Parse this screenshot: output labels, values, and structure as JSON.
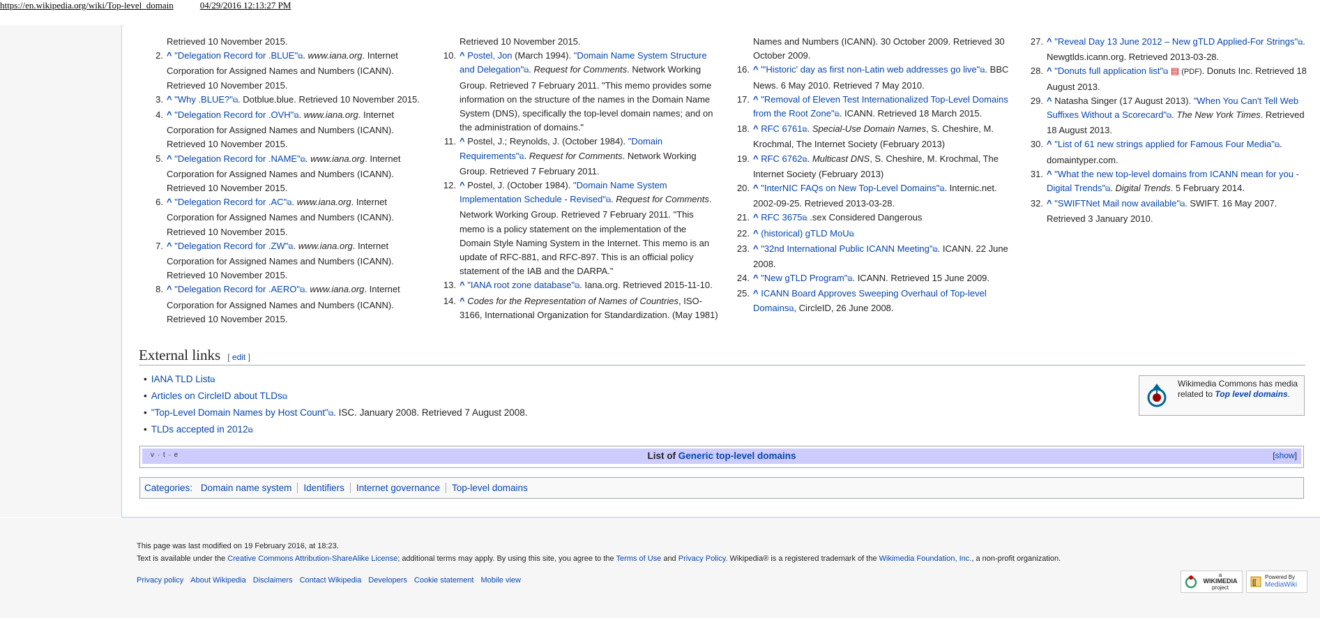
{
  "browser": {
    "url": "https://en.wikipedia.org/wiki/Top-level_domain",
    "timestamp": "04/29/2016 12:13:27 PM"
  },
  "references": {
    "col1_top": "Retrieved 10 November 2015.",
    "col1": [
      {
        "num": "2.",
        "title": "\"Delegation Record for .BLUE\"",
        "site": "www.iana.org",
        "rest": ". Internet Corporation for Assigned Names and Numbers (ICANN). Retrieved 10 November 2015."
      },
      {
        "num": "3.",
        "title": "\"Why .BLUE?\"",
        "site": "",
        "rest": ". Dotblue.blue. Retrieved 10 November 2015."
      },
      {
        "num": "4.",
        "title": "\"Delegation Record for .OVH\"",
        "site": "www.iana.org",
        "rest": ". Internet Corporation for Assigned Names and Numbers (ICANN). Retrieved 10 November 2015."
      },
      {
        "num": "5.",
        "title": "\"Delegation Record for .NAME\"",
        "site": "www.iana.org",
        "rest": ". Internet Corporation for Assigned Names and Numbers (ICANN). Retrieved 10 November 2015."
      },
      {
        "num": "6.",
        "title": "\"Delegation Record for .AC\"",
        "site": "www.iana.org",
        "rest": ". Internet Corporation for Assigned Names and Numbers (ICANN). Retrieved 10 November 2015."
      },
      {
        "num": "7.",
        "title": "\"Delegation Record for .ZW\"",
        "site": "www.iana.org",
        "rest": ". Internet Corporation for Assigned Names and Numbers (ICANN). Retrieved 10 November 2015."
      },
      {
        "num": "8.",
        "title": "\"Delegation Record for .AERO\"",
        "site": "www.iana.org",
        "rest": ". Internet Corporation for Assigned Names and Numbers (ICANN). Retrieved 10 November 2015."
      }
    ],
    "col2_top": "Retrieved 10 November 2015.",
    "col2": [
      {
        "num": "10.",
        "pre": "Postel, Jon",
        "pre_link": true,
        "mid": " (March 1994). ",
        "title": "\"Domain Name System Structure and Delegation\"",
        "italic": "Request for Comments",
        "rest": ". Network Working Group. Retrieved 7 February 2011. \"This memo provides some information on the structure of the names in the Domain Name System (DNS), specifically the top-level domain names; and on the administration of domains.\""
      },
      {
        "num": "11.",
        "pre": "Postel, J.; Reynolds, J.",
        "pre_link": false,
        "mid": " (October 1984). ",
        "title": "\"Domain Requirements\"",
        "italic": "Request for Comments",
        "rest": ". Network Working Group. Retrieved 7 February 2011."
      },
      {
        "num": "12.",
        "pre": "Postel, J.",
        "pre_link": false,
        "mid": " (October 1984). ",
        "title": "\"Domain Name System Implementation Schedule - Revised\"",
        "italic": "Request for Comments",
        "rest": ". Network Working Group. Retrieved 7 February 2011. \"This memo is a policy statement on the implementation of the Domain Style Naming System in the Internet. This memo is an update of RFC-881, and RFC-897. This is an official policy statement of the IAB and the DARPA.\""
      },
      {
        "num": "13.",
        "pre": "",
        "pre_link": false,
        "mid": "",
        "title": "\"IANA root zone database\"",
        "italic": "",
        "rest": ". Iana.org. Retrieved 2015-11-10."
      },
      {
        "num": "14.",
        "pre": "",
        "pre_link": false,
        "mid": "",
        "title": "",
        "italic": "Codes for the Representation of Names of Countries",
        "rest": ", ISO-3166, International Organization for Standardization. (May 1981)"
      }
    ],
    "col3_top": "Names and Numbers (ICANN). 30 October 2009. Retrieved 30 October 2009.",
    "col3": [
      {
        "num": "16.",
        "title": "\"'Historic' day as first non-Latin web addresses go live\"",
        "rest": ". BBC News. 6 May 2010. Retrieved 7 May 2010."
      },
      {
        "num": "17.",
        "title": "\"Removal of Eleven Test Internationalized Top-Level Domains from the Root Zone\"",
        "rest": ". ICANN. Retrieved 18 March 2015."
      },
      {
        "num": "18.",
        "title": "RFC 6761",
        "italic": "Special-Use Domain Names",
        "rest": ", S. Cheshire, M. Krochmal, The Internet Society (February 2013)"
      },
      {
        "num": "19.",
        "title": "RFC 6762",
        "italic": "Multicast DNS",
        "rest": ", S. Cheshire, M. Krochmal, The Internet Society (February 2013)"
      },
      {
        "num": "20.",
        "title": "\"InterNIC FAQs on New Top-Level Domains\"",
        "rest": ". Internic.net. 2002-09-25. Retrieved 2013-03-28."
      },
      {
        "num": "21.",
        "title": "RFC 3675",
        "rest": " .sex Considered Dangerous"
      },
      {
        "num": "22.",
        "title": "(historical) gTLD MoU",
        "rest": ""
      },
      {
        "num": "23.",
        "title": "\"32nd International Public ICANN Meeting\"",
        "rest": ". ICANN. 22 June 2008."
      },
      {
        "num": "24.",
        "title": "\"New gTLD Program\"",
        "rest": ". ICANN. Retrieved 15 June 2009."
      },
      {
        "num": "25.",
        "title": "ICANN Board Approves Sweeping Overhaul of Top-level Domains",
        "rest": ", CircleID, 26 June 2008."
      }
    ],
    "col4": [
      {
        "num": "27.",
        "pre": "",
        "title": "\"Reveal Day 13 June 2012 – New gTLD Applied-For Strings\"",
        "italic": "",
        "rest": ". Newgtlds.icann.org. Retrieved 2013-03-28."
      },
      {
        "num": "28.",
        "pre": "",
        "title": "\"Donuts full application list\"",
        "pdf": " (PDF)",
        "italic": "",
        "rest": ". Donuts Inc. Retrieved 18 August 2013."
      },
      {
        "num": "29.",
        "pre": "Natasha Singer (17 August 2013). ",
        "title": "\"When You Can't Tell Web Suffixes Without a Scorecard\"",
        "italic": "The New York Times",
        "rest": ". Retrieved 18 August 2013."
      },
      {
        "num": "30.",
        "pre": "",
        "title": "\"List of 61 new strings applied for Famous Four Media\"",
        "italic": "",
        "rest": ". domaintyper.com."
      },
      {
        "num": "31.",
        "pre": "",
        "title": "\"What the new top-level domains from ICANN mean for you - Digital Trends\"",
        "italic": "Digital Trends",
        "rest": ". 5 February 2014."
      },
      {
        "num": "32.",
        "pre": "",
        "title": "\"SWIFTNet Mail now available\"",
        "italic": "",
        "rest": ". SWIFT. 16 May 2007. Retrieved 3 January 2010."
      }
    ]
  },
  "external_links": {
    "heading": "External links",
    "edit": "edit",
    "items": [
      {
        "link": "IANA TLD List",
        "rest": ""
      },
      {
        "link": "Articles on CircleID about TLDs",
        "rest": ""
      },
      {
        "link": "\"Top-Level Domain Names by Host Count\"",
        "rest": ". ISC. January 2008. Retrieved 7 August 2008."
      },
      {
        "link": "TLDs accepted in 2012",
        "rest": ""
      }
    ]
  },
  "commons": {
    "text": "Wikimedia Commons has media related to ",
    "link": "Top level domains",
    "end": "."
  },
  "navbox": {
    "vte": "v · t · e",
    "title_plain": "List of ",
    "title_link": "Generic top-level domains",
    "show": "show"
  },
  "categories": {
    "label": "Categories:",
    "items": [
      "Domain name system",
      "Identifiers",
      "Internet governance",
      "Top-level domains"
    ]
  },
  "footer": {
    "last_modified": "This page was last modified on 19 February 2016, at 18:23.",
    "license_pre": "Text is available under the ",
    "license_link": "Creative Commons Attribution-ShareAlike License",
    "license_mid": "; additional terms may apply. By using this site, you agree to the ",
    "terms": "Terms of Use",
    "and": " and ",
    "privacy": "Privacy Policy",
    "trademark": ". Wikipedia® is a registered trademark of the ",
    "foundation": "Wikimedia Foundation, Inc.",
    "end": ", a non-profit organization.",
    "links": [
      "Privacy policy",
      "About Wikipedia",
      "Disclaimers",
      "Contact Wikipedia",
      "Developers",
      "Cookie statement",
      "Mobile view"
    ],
    "badge1_top": "a",
    "badge1": "WIKIMEDIA",
    "badge1_sub": "project",
    "badge2_top": "Powered By",
    "badge2": "MediaWiki"
  }
}
